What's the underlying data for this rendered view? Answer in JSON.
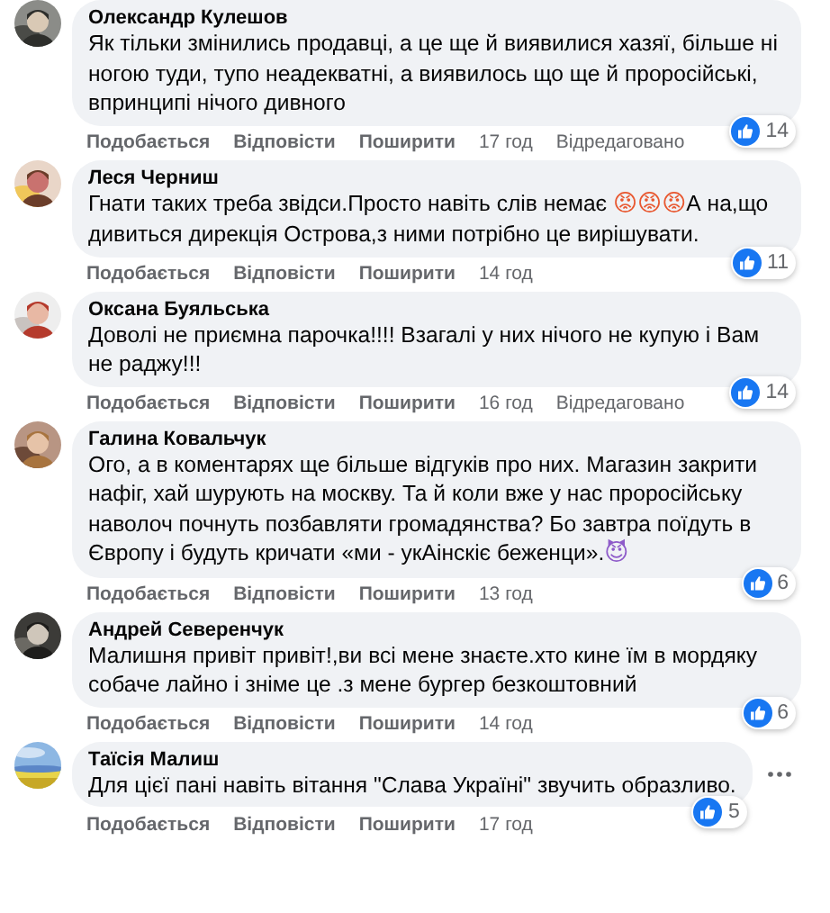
{
  "comments": [
    {
      "author": "Олександр Кулешов",
      "body": [
        {
          "kind": "text",
          "text": "Як тільки змінились продавці, а це ще й виявилися хазяї, більше ні ногою туди, тупо неадекватні, а виявилось що ще й проросійські, впринципі нічого дивного"
        }
      ],
      "actions": [
        "Подобається",
        "Відповісти",
        "Поширити"
      ],
      "time": "17 год",
      "edited": "Відредаговано",
      "reactions": "14",
      "menu": false
    },
    {
      "author": "Леся Черниш",
      "body": [
        {
          "kind": "text",
          "text": "Гнати таких треба звідси.Просто навіть слів немає "
        },
        {
          "kind": "emoji",
          "text": "😡😡😡",
          "color": "#e8572f"
        },
        {
          "kind": "text",
          "text": "А на,що дивиться дирекція Острова,з ними потрібно це вирішувати."
        }
      ],
      "actions": [
        "Подобається",
        "Відповісти",
        "Поширити"
      ],
      "time": "14 год",
      "reactions": "11",
      "menu": false
    },
    {
      "author": "Оксана Буяльська",
      "body": [
        {
          "kind": "text",
          "text": "Доволі не приємна парочка!!!! Взагалі у них нічого не купую і Вам не раджу!!!"
        }
      ],
      "actions": [
        "Подобається",
        "Відповісти",
        "Поширити"
      ],
      "time": "16 год",
      "edited": "Відредаговано",
      "reactions": "14",
      "menu": false
    },
    {
      "author": "Галина Ковальчук",
      "body": [
        {
          "kind": "text",
          "text": "Ого, а в коментарях ще більше відгуків про них. Магазин закрити нафіг, хай шурують на москву. Та й коли вже у нас проросійську наволоч почнуть позбавляти громадянства? Бо завтра поїдуть в Європу і будуть кричати «ми - укАінскіє беженци»."
        },
        {
          "kind": "emoji",
          "text": "😈",
          "color": "#8e5bc9"
        }
      ],
      "actions": [
        "Подобається",
        "Відповісти",
        "Поширити"
      ],
      "time": "13 год",
      "reactions": "6",
      "menu": false
    },
    {
      "author": "Андрей Северенчук",
      "body": [
        {
          "kind": "text",
          "text": "Малишня привіт привіт!,ви всі мене знаєте.хто кине їм в мордяку собаче лайно і зніме це .з мене бургер безкоштовний"
        }
      ],
      "actions": [
        "Подобається",
        "Відповісти",
        "Поширити"
      ],
      "time": "14 год",
      "reactions": "6",
      "menu": false
    },
    {
      "author": "Таїсія Малиш",
      "body": [
        {
          "kind": "text",
          "text": "Для цієї пані навіть вітання \"Слава Україні\" звучить образливо."
        }
      ],
      "actions": [
        "Подобається",
        "Відповісти",
        "Поширити"
      ],
      "time": "17 год",
      "reactions": "5",
      "menu": true
    }
  ]
}
